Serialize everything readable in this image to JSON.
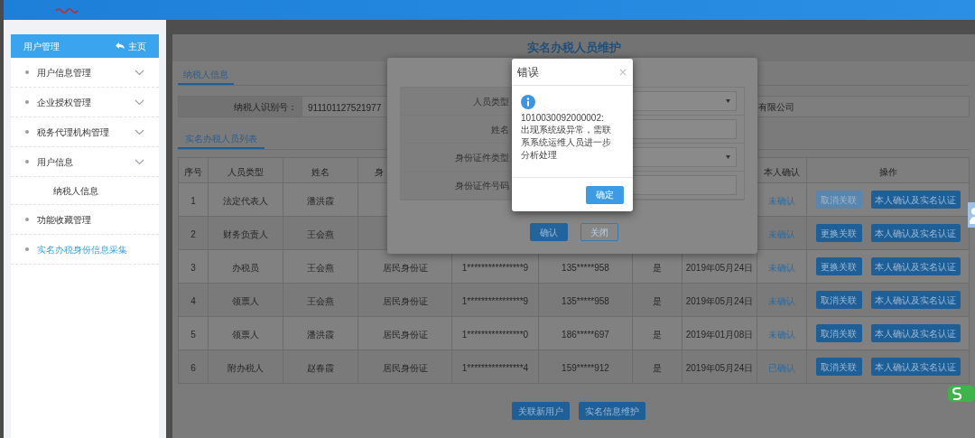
{
  "sidebar": {
    "title": "用户管理",
    "home_link": "主页",
    "items": [
      {
        "label": "用户信息管理",
        "kind": "group",
        "selected": false
      },
      {
        "label": "企业授权管理",
        "kind": "group",
        "selected": false
      },
      {
        "label": "税务代理机构管理",
        "kind": "group",
        "selected": false
      },
      {
        "label": "用户信息",
        "kind": "group",
        "selected": false,
        "children": [
          {
            "label": "纳税人信息",
            "kind": "link",
            "selected": false
          }
        ]
      },
      {
        "label": "功能收藏管理",
        "kind": "link",
        "selected": false
      },
      {
        "label": "实名办税身份信息采集",
        "kind": "link",
        "selected": true
      }
    ]
  },
  "page": {
    "title": "实名办税人员维护",
    "tabs": [
      {
        "label": "纳税人信息",
        "selected": true
      }
    ],
    "taxpayer": {
      "label": "纳税人识别号：",
      "value": "911101127521977",
      "company": "有限公司"
    },
    "list_tabs": [
      {
        "label": "实名办税人员列表",
        "selected": true
      }
    ],
    "table": {
      "columns": [
        "序号",
        "人员类型",
        "姓名",
        "身",
        "",
        "",
        "",
        "",
        "本人确认",
        "操作"
      ],
      "rows": [
        {
          "cells": [
            "1",
            "法定代表人",
            "潘洪霞"
          ],
          "status": "未确认",
          "actions": [
            {
              "label": "取消关联",
              "disabled": true
            },
            {
              "label": "本人确认及实名认证",
              "disabled": false
            }
          ]
        },
        {
          "cells": [
            "2",
            "财务负责人",
            "王会燕"
          ],
          "status": "未确认",
          "actions": [
            {
              "label": "更换关联",
              "disabled": false
            },
            {
              "label": "本人确认及实名认证",
              "disabled": false
            }
          ]
        },
        {
          "cells": [
            "3",
            "办税员",
            "王会燕",
            "居民身份证",
            "1****************9",
            "135*****958",
            "是",
            "2019年05月24日"
          ],
          "status": "未确认",
          "actions": [
            {
              "label": "更换关联",
              "disabled": false
            },
            {
              "label": "本人确认及实名认证",
              "disabled": false
            }
          ]
        },
        {
          "cells": [
            "4",
            "领票人",
            "王会燕",
            "居民身份证",
            "1****************9",
            "135*****958",
            "是",
            "2019年05月24日"
          ],
          "status": "未确认",
          "actions": [
            {
              "label": "取消关联",
              "disabled": false
            },
            {
              "label": "本人确认及实名认证",
              "disabled": false
            }
          ]
        },
        {
          "cells": [
            "5",
            "领票人",
            "潘洪霞",
            "居民身份证",
            "1****************0",
            "186*****697",
            "是",
            "2019年01月08日"
          ],
          "status": "未确认",
          "actions": [
            {
              "label": "取消关联",
              "disabled": false
            },
            {
              "label": "本人确认及实名认证",
              "disabled": false
            }
          ]
        },
        {
          "cells": [
            "6",
            "附办税人",
            "赵春霞",
            "居民身份证",
            "1****************4",
            "159*****912",
            "是",
            "2019年05月24日"
          ],
          "status": "已确认",
          "actions": [
            {
              "label": "取消关联",
              "disabled": false
            },
            {
              "label": "本人确认及实名认证",
              "disabled": false
            }
          ]
        }
      ]
    },
    "buttons": [
      "关联新用户",
      "实名信息维护"
    ]
  },
  "form_dialog": {
    "fields": [
      {
        "label": "人员类型",
        "kind": "select"
      },
      {
        "label": "姓名",
        "kind": "text"
      },
      {
        "label": "身份证件类型",
        "kind": "select"
      },
      {
        "label": "身份证件号码",
        "kind": "text"
      }
    ],
    "buttons": [
      {
        "label": "确认",
        "kind": "primary"
      },
      {
        "label": "关闭",
        "kind": "outline"
      }
    ]
  },
  "error_dialog": {
    "title": "错误",
    "close": "×",
    "code": "1010030092000002:",
    "message": "出现系统级异常，需联系系统运维人员进一步分析处理",
    "button": "确定"
  }
}
